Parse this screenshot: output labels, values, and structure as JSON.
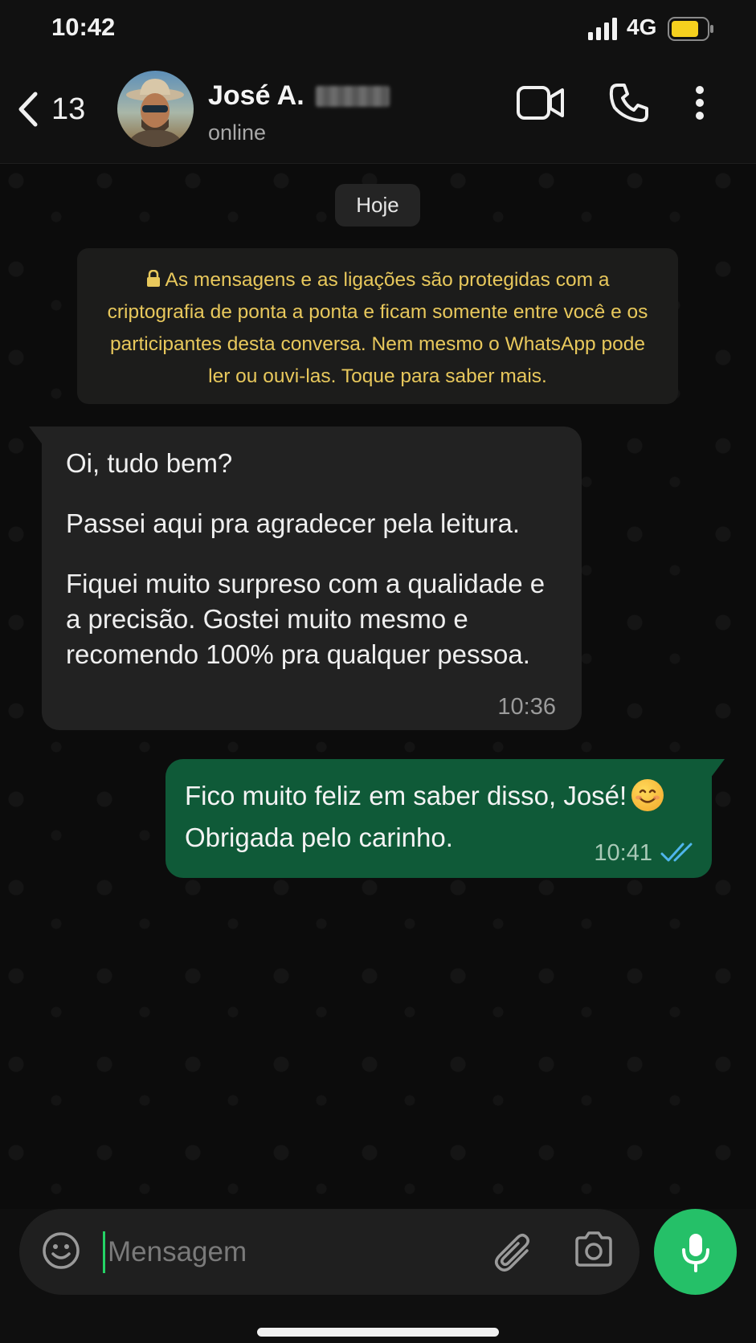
{
  "status_bar": {
    "time": "10:42",
    "network": "4G",
    "battery_color": "#f5d01e",
    "battery_level": 0.75
  },
  "header": {
    "back_count": "13",
    "contact_name": "José A.",
    "contact_status": "online",
    "icons": [
      "chevron-left-icon",
      "video-call-icon",
      "phone-icon",
      "more-vertical-icon"
    ]
  },
  "chat": {
    "day_label": "Hoje",
    "e2e_notice": "As mensagens e as ligações são protegidas com a criptografia de ponta a ponta e ficam somente entre você e os participantes desta conversa. Nem mesmo o WhatsApp pode ler ou ouvi-las. Toque para saber mais.",
    "incoming": {
      "paragraphs": [
        "Oi, tudo bem?",
        "Passei aqui pra agradecer pela leitura.",
        "Fiquei muito surpreso com a qualidade e a precisão. Gostei muito mesmo e recomendo 100% pra qualquer pessoa."
      ],
      "time": "10:36"
    },
    "outgoing": {
      "text_line_1": "Fico muito feliz em saber disso, José!",
      "emoji": "smiling-face-emoji",
      "text_line_2": "Obrigada pelo carinho.",
      "time": "10:41",
      "status": "read"
    }
  },
  "composer": {
    "placeholder": "Mensagem",
    "icons": [
      "emoji-icon",
      "paperclip-icon",
      "camera-icon",
      "microphone-icon"
    ]
  },
  "colors": {
    "outgoing_bubble": "#0f5a38",
    "incoming_bubble": "#222222",
    "notice_text": "#e8c85c",
    "mic_button": "#25c068",
    "read_ticks": "#4fb6ec"
  }
}
